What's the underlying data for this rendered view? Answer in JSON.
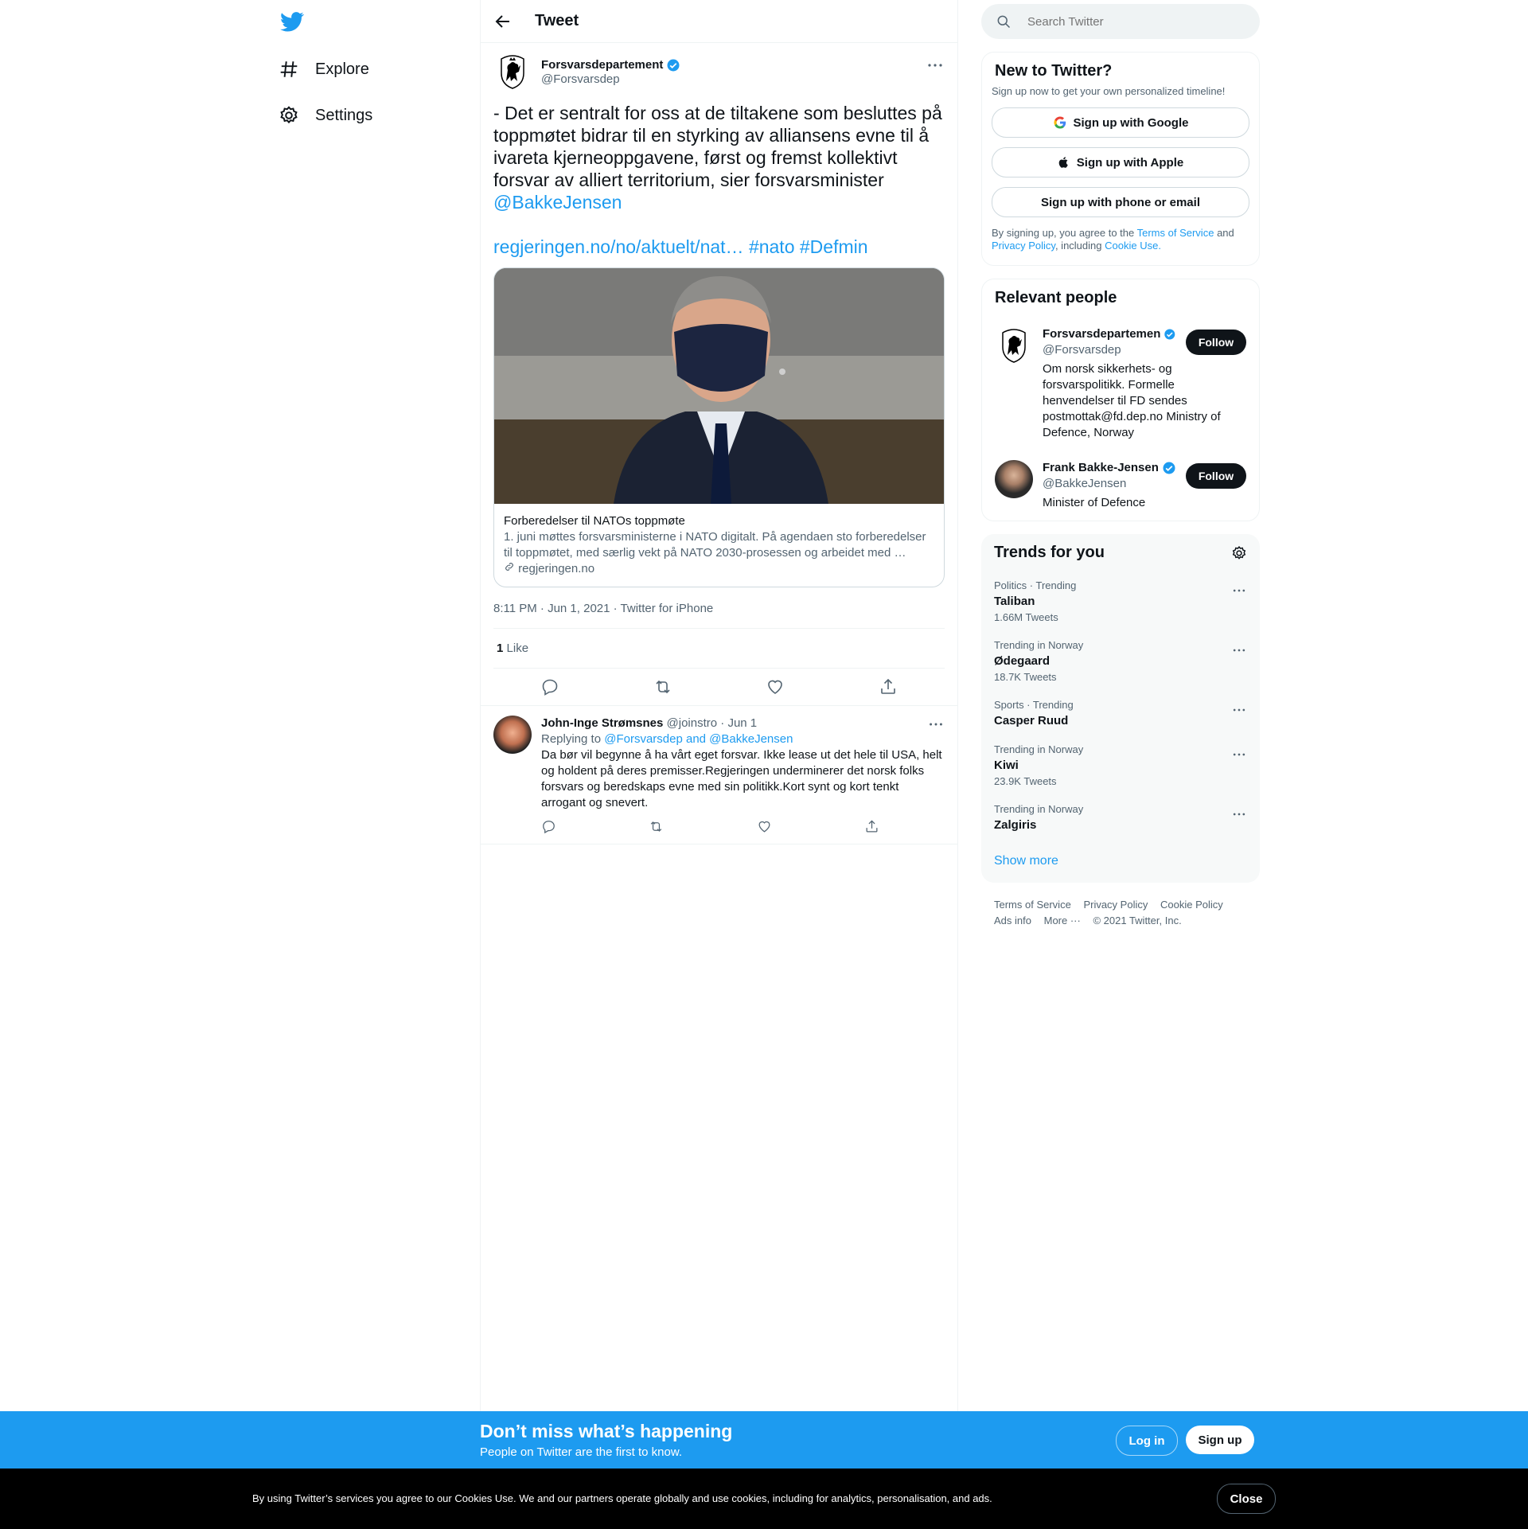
{
  "nav": {
    "explore": "Explore",
    "settings": "Settings"
  },
  "header": {
    "title": "Tweet"
  },
  "tweet": {
    "name": "Forsvarsdepartement",
    "handle": "@Forsvarsdep",
    "text": "- Det er sentralt for oss at de tiltakene som besluttes på toppmøtet bidrar til en styrking av alliansens evne til å ivareta kjerneoppgavene, først og fremst kollektivt forsvar av alliert territorium, sier forsvarsminister",
    "mention": "@BakkeJensen",
    "link": "regjeringen.no/no/aktuelt/nat…",
    "tag1": "#nato",
    "tag2": "#Defmin",
    "card_title": "Forberedelser til NATOs toppmøte",
    "card_desc": "1. juni møttes forsvarsministerne i NATO digitalt. På agendaen sto forberedelser til toppmøtet, med særlig vekt på NATO 2030-prosessen og arbeidet med …",
    "card_domain": "regjeringen.no",
    "timestamp": "8:11 PM · Jun 1, 2021 · Twitter for iPhone",
    "likes_count": "1",
    "likes_label": "Like"
  },
  "reply": {
    "name": "John-Inge Strømsnes",
    "handle_date": "@joinstro · Jun 1",
    "replying_prefix": "Replying to",
    "replying_to": "@Forsvarsdep and @BakkeJensen",
    "text": "Da bør vil begynne å ha vårt eget forsvar. Ikke lease ut det hele til USA, helt og holdent på deres premisser.Regjeringen underminerer det norsk folks forsvars og beredskaps evne med sin politikk.Kort synt og kort tenkt arrogant og snevert."
  },
  "search": {
    "placeholder": "Search Twitter"
  },
  "signup": {
    "title": "New to Twitter?",
    "subtitle": "Sign up now to get your own personalized timeline!",
    "google": "Sign up with Google",
    "apple": "Sign up with Apple",
    "phone": "Sign up with phone or email",
    "legal_1": "By signing up, you agree to the",
    "tos": "Terms of Service",
    "and": "and",
    "privacy": "Privacy Policy",
    "including": ", including",
    "cookie": "Cookie Use."
  },
  "people": {
    "title": "Relevant people",
    "p1_name": "Forsvarsdepartemen",
    "p1_handle": "@Forsvarsdep",
    "p1_bio": "Om norsk sikkerhets- og forsvarspolitikk. Formelle henvendelser til FD sendes postmottak@fd.dep.no Ministry of Defence, Norway",
    "p2_name": "Frank Bakke-Jensen",
    "p2_handle": "@BakkeJensen",
    "p2_bio": "Minister of Defence",
    "follow": "Follow"
  },
  "trends": {
    "title": "Trends for you",
    "items": [
      {
        "meta": "Politics · Trending",
        "name": "Taliban",
        "count": "1.66M Tweets"
      },
      {
        "meta": "Trending in Norway",
        "name": "Ødegaard",
        "count": "18.7K Tweets"
      },
      {
        "meta": "Sports · Trending",
        "name": "Casper Ruud",
        "count": ""
      },
      {
        "meta": "Trending in Norway",
        "name": "Kiwi",
        "count": "23.9K Tweets"
      },
      {
        "meta": "Trending in Norway",
        "name": "Zalgiris",
        "count": ""
      }
    ],
    "show_more": "Show more"
  },
  "footer": {
    "tos": "Terms of Service",
    "privacy": "Privacy Policy",
    "cookie": "Cookie Policy",
    "ads": "Ads info",
    "more": "More ···",
    "copyright": "© 2021 Twitter, Inc."
  },
  "banner": {
    "headline": "Don’t miss what’s happening",
    "sub": "People on Twitter are the first to know.",
    "login": "Log in",
    "signup": "Sign up"
  },
  "cookie_bar": {
    "text": "By using Twitter’s services you agree to our Cookies Use. We and our partners operate globally and use cookies, including for analytics, personalisation, and ads.",
    "close": "Close"
  },
  "colors": {
    "accent": "#1d9bf0",
    "text": "#0f1419",
    "muted": "#536471"
  }
}
